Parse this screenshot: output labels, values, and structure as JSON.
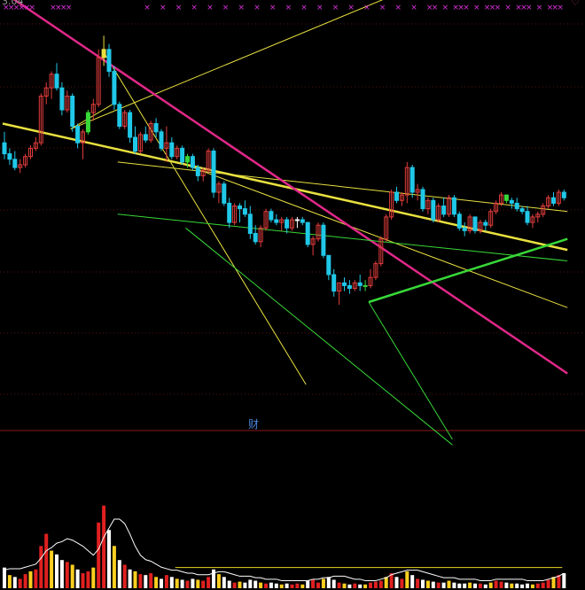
{
  "top_label": "3.04",
  "mid_label": "财",
  "colors": {
    "background": "#000000",
    "up": "#e23c3c",
    "down": "#20c8e8",
    "flat": "#ffffff",
    "marker": "#e030e0",
    "trend_yellow": "#e8e040",
    "trend_magenta": "#e02888",
    "trend_green": "#38d838",
    "volume_up": "#e02020",
    "volume_alt": "#ffd020",
    "volume_flat": "#ffffff",
    "avg_line": "#ffffff",
    "ref_line": "#e8d820"
  },
  "chart_data": {
    "type": "candlestick",
    "price_scale": [
      0,
      40
    ],
    "volume_scale": [
      0,
      100
    ],
    "candles": [
      [
        14.0,
        16.0,
        11.0,
        12.0
      ],
      [
        12.0,
        13.0,
        10.0,
        11.0
      ],
      [
        11.0,
        12.5,
        9.0,
        9.5
      ],
      [
        9.5,
        11.0,
        8.5,
        10.0
      ],
      [
        10.0,
        12.0,
        9.5,
        11.5
      ],
      [
        11.5,
        13.5,
        11.0,
        13.0
      ],
      [
        13.0,
        15.0,
        12.5,
        14.0
      ],
      [
        14.0,
        23.0,
        13.5,
        22.5
      ],
      [
        22.5,
        25.0,
        21.0,
        24.0
      ],
      [
        24.0,
        27.0,
        22.0,
        26.5
      ],
      [
        26.5,
        28.5,
        23.5,
        24.0
      ],
      [
        24.0,
        25.0,
        19.0,
        20.0
      ],
      [
        20.0,
        23.5,
        19.5,
        22.5
      ],
      [
        22.5,
        23.0,
        16.0,
        17.0
      ],
      [
        17.0,
        17.5,
        13.0,
        14.0
      ],
      [
        14.0,
        16.5,
        11.0,
        16.0
      ],
      [
        16.0,
        20.0,
        15.5,
        19.5
      ],
      [
        19.5,
        22.0,
        18.0,
        21.0
      ],
      [
        21.0,
        31.0,
        20.5,
        29.5
      ],
      [
        29.5,
        33.5,
        28.0,
        31.0
      ],
      [
        31.0,
        32.0,
        26.0,
        27.0
      ],
      [
        27.0,
        28.0,
        20.0,
        21.0
      ],
      [
        21.0,
        21.5,
        16.5,
        17.0
      ],
      [
        17.0,
        20.0,
        16.5,
        19.5
      ],
      [
        19.5,
        20.0,
        14.0,
        15.0
      ],
      [
        15.0,
        17.0,
        12.0,
        12.5
      ],
      [
        12.5,
        16.0,
        12.0,
        15.5
      ],
      [
        15.5,
        17.0,
        14.0,
        14.5
      ],
      [
        14.5,
        18.0,
        14.0,
        17.5
      ],
      [
        17.5,
        18.5,
        15.0,
        16.0
      ],
      [
        16.0,
        16.5,
        12.5,
        13.0
      ],
      [
        13.0,
        17.0,
        10.5,
        14.0
      ],
      [
        14.0,
        15.0,
        11.0,
        11.5
      ],
      [
        11.5,
        13.5,
        11.0,
        13.0
      ],
      [
        13.0,
        13.5,
        10.0,
        10.5
      ],
      [
        10.5,
        12.0,
        9.5,
        11.5
      ],
      [
        11.5,
        12.0,
        9.0,
        9.5
      ],
      [
        9.5,
        10.0,
        7.0,
        8.0
      ],
      [
        8.0,
        9.5,
        7.0,
        9.0
      ],
      [
        9.0,
        13.0,
        8.5,
        12.5
      ],
      [
        12.5,
        13.0,
        4.0,
        5.0
      ],
      [
        5.0,
        7.0,
        3.0,
        6.5
      ],
      [
        6.5,
        7.0,
        2.5,
        3.0
      ],
      [
        3.0,
        4.0,
        -1.5,
        -0.5
      ],
      [
        -0.5,
        3.0,
        -1.0,
        2.5
      ],
      [
        2.5,
        3.0,
        -0.5,
        2.0
      ],
      [
        2.0,
        3.5,
        0.5,
        1.0
      ],
      [
        1.0,
        2.5,
        -3.5,
        -2.5
      ],
      [
        -2.5,
        -1.0,
        -4.5,
        -4.0
      ],
      [
        -4.0,
        -1.0,
        -5.0,
        -1.5
      ],
      [
        -1.5,
        2.0,
        -2.0,
        1.5
      ],
      [
        1.5,
        2.0,
        -0.5,
        0.0
      ],
      [
        0.0,
        1.0,
        -1.0,
        -0.5
      ],
      [
        -0.5,
        0.5,
        -2.0,
        0.0
      ],
      [
        0.0,
        0.5,
        -2.5,
        -1.5
      ],
      [
        -1.5,
        0.5,
        -2.0,
        0.0
      ],
      [
        0.0,
        0.5,
        -1.5,
        0.0
      ],
      [
        0.0,
        0.5,
        -1.0,
        -0.5
      ],
      [
        -0.5,
        -0.5,
        -5.0,
        -4.5
      ],
      [
        -4.5,
        -3.0,
        -6.5,
        -3.5
      ],
      [
        -3.5,
        -0.5,
        -4.0,
        -1.0
      ],
      [
        -1.0,
        -0.5,
        -7.0,
        -6.5
      ],
      [
        -6.5,
        -7.0,
        -11.0,
        -10.0
      ],
      [
        -10.0,
        -9.0,
        -14.0,
        -13.0
      ],
      [
        -13.0,
        -11.5,
        -15.5,
        -11.5
      ],
      [
        -11.5,
        -10.5,
        -13.0,
        -12.0
      ],
      [
        -12.0,
        -11.0,
        -13.5,
        -12.5
      ],
      [
        -12.5,
        -11.0,
        -13.0,
        -11.5
      ],
      [
        -11.5,
        -10.0,
        -13.0,
        -12.0
      ],
      [
        -12.0,
        -11.0,
        -13.0,
        -12.0
      ],
      [
        -12.0,
        -9.0,
        -12.5,
        -10.5
      ],
      [
        -10.5,
        -7.5,
        -11.0,
        -8.0
      ],
      [
        -8.0,
        -3.0,
        -8.5,
        -3.5
      ],
      [
        -3.5,
        1.0,
        -4.0,
        0.5
      ],
      [
        0.5,
        5.5,
        0.0,
        5.0
      ],
      [
        5.0,
        6.0,
        3.0,
        3.5
      ],
      [
        3.5,
        5.0,
        2.5,
        4.5
      ],
      [
        4.5,
        10.5,
        3.0,
        9.5
      ],
      [
        9.5,
        10.0,
        4.0,
        5.0
      ],
      [
        5.0,
        6.5,
        3.5,
        5.5
      ],
      [
        5.5,
        6.0,
        1.5,
        2.0
      ],
      [
        2.0,
        4.0,
        1.0,
        3.5
      ],
      [
        3.5,
        4.0,
        -0.5,
        0.0
      ],
      [
        0.0,
        3.0,
        -0.5,
        2.5
      ],
      [
        2.5,
        4.0,
        0.5,
        1.0
      ],
      [
        1.0,
        4.5,
        0.5,
        4.0
      ],
      [
        4.0,
        4.5,
        0.5,
        1.0
      ],
      [
        1.0,
        1.5,
        -2.0,
        -1.5
      ],
      [
        -1.5,
        -0.5,
        -3.0,
        -2.0
      ],
      [
        -2.0,
        1.0,
        -2.5,
        0.5
      ],
      [
        0.5,
        0.5,
        -2.5,
        -2.0
      ],
      [
        -2.0,
        0.0,
        -2.5,
        -0.5
      ],
      [
        -0.5,
        0.0,
        -2.0,
        -1.0
      ],
      [
        -1.0,
        2.0,
        -1.5,
        1.5
      ],
      [
        1.5,
        3.5,
        1.0,
        3.0
      ],
      [
        3.0,
        5.0,
        2.5,
        4.5
      ],
      [
        4.5,
        4.5,
        3.0,
        3.5
      ],
      [
        3.5,
        4.0,
        2.0,
        3.0
      ],
      [
        3.0,
        4.0,
        1.5,
        2.0
      ],
      [
        2.0,
        2.5,
        1.0,
        1.5
      ],
      [
        1.5,
        2.5,
        -1.0,
        -0.5
      ],
      [
        -0.5,
        1.0,
        -1.5,
        0.5
      ],
      [
        0.5,
        1.5,
        -0.5,
        1.0
      ],
      [
        1.0,
        3.0,
        0.5,
        2.5
      ],
      [
        2.5,
        4.5,
        2.0,
        4.0
      ],
      [
        4.0,
        5.0,
        2.5,
        3.0
      ],
      [
        3.0,
        5.5,
        2.5,
        5.0
      ],
      [
        5.0,
        5.5,
        3.5,
        4.0
      ]
    ],
    "volumes": [
      22,
      14,
      12,
      10,
      15,
      18,
      20,
      45,
      58,
      40,
      36,
      30,
      28,
      25,
      20,
      16,
      18,
      22,
      70,
      88,
      62,
      45,
      30,
      25,
      20,
      18,
      15,
      14,
      16,
      12,
      10,
      14,
      12,
      10,
      9,
      8,
      10,
      9,
      8,
      12,
      20,
      15,
      12,
      8,
      6,
      7,
      6,
      9,
      8,
      6,
      5,
      6,
      5,
      4,
      5,
      4,
      5,
      4,
      8,
      9,
      6,
      10,
      12,
      9,
      6,
      5,
      4,
      5,
      4,
      4,
      6,
      7,
      8,
      12,
      16,
      12,
      10,
      18,
      14,
      10,
      9,
      8,
      7,
      6,
      6,
      8,
      6,
      5,
      5,
      6,
      5,
      5,
      4,
      6,
      8,
      7,
      6,
      5,
      5,
      4,
      5,
      4,
      5,
      6,
      9,
      12,
      14,
      16
    ],
    "volume_ma": [
      12,
      13,
      13,
      13,
      14,
      15,
      16,
      20,
      25,
      27,
      30,
      31,
      33,
      32,
      30,
      28,
      25,
      22,
      26,
      34,
      40,
      46,
      46,
      43,
      36,
      28,
      22,
      19,
      18,
      16,
      14,
      13,
      12,
      12,
      11,
      10,
      10,
      9,
      9,
      9,
      10,
      11,
      11,
      10,
      9,
      8,
      8,
      8,
      7,
      7,
      6,
      6,
      6,
      5,
      5,
      5,
      5,
      5,
      5,
      6,
      6,
      7,
      7,
      8,
      8,
      8,
      7,
      6,
      6,
      5,
      5,
      5,
      6,
      7,
      9,
      10,
      11,
      12,
      12,
      12,
      11,
      10,
      9,
      8,
      7,
      7,
      7,
      6,
      6,
      6,
      6,
      5,
      5,
      5,
      6,
      6,
      6,
      6,
      6,
      6,
      5,
      5,
      5,
      5,
      6,
      7,
      8,
      10
    ],
    "volume_ref_level": 10,
    "trendlines": [
      {
        "color": "trend_yellow",
        "width": 1,
        "from": [
          13,
          16.5
        ],
        "to": [
          108,
          54
        ]
      },
      {
        "color": "trend_yellow",
        "width": 1,
        "from": [
          13,
          16.5
        ],
        "to": [
          21,
          21.0
        ]
      },
      {
        "color": "trend_yellow",
        "width": 1,
        "from": [
          22,
          10.5
        ],
        "to": [
          108,
          1.5
        ]
      },
      {
        "color": "trend_yellow",
        "width": 2.5,
        "from": [
          0,
          17.5
        ],
        "to": [
          108,
          -5.5
        ]
      },
      {
        "color": "trend_yellow",
        "width": 1,
        "from": [
          19,
          31
        ],
        "to": [
          58,
          -30
        ]
      },
      {
        "color": "trend_yellow",
        "width": 1,
        "from": [
          35,
          10
        ],
        "to": [
          108,
          -16
        ]
      },
      {
        "color": "trend_magenta",
        "width": 2.5,
        "from": [
          0,
          41.5
        ],
        "to": [
          108,
          -28
        ]
      },
      {
        "color": "trend_green",
        "width": 1,
        "from": [
          22,
          1
        ],
        "to": [
          108,
          -7.5
        ]
      },
      {
        "color": "trend_green",
        "width": 1,
        "from": [
          35,
          -1.5
        ],
        "to": [
          86,
          -41
        ]
      },
      {
        "color": "trend_green",
        "width": 1,
        "from": [
          70,
          -15
        ],
        "to": [
          86,
          -40
        ]
      },
      {
        "color": "trend_green",
        "width": 2.5,
        "from": [
          70,
          -15
        ],
        "to": [
          108,
          -3.5
        ]
      }
    ],
    "markers_top": [
      0,
      1,
      2,
      3,
      4,
      5,
      9,
      10,
      11,
      12,
      26,
      27,
      28,
      29,
      30,
      31,
      32,
      33,
      34,
      35,
      36,
      37,
      38,
      39,
      40,
      41,
      42,
      43,
      44,
      45,
      46,
      47,
      48,
      49,
      50,
      51,
      52,
      53,
      54,
      55,
      56,
      57,
      58,
      59,
      60,
      61,
      62,
      63,
      64,
      65,
      66,
      67,
      68,
      69,
      70,
      71,
      72,
      73,
      74,
      75,
      76,
      77,
      78,
      79,
      80,
      81,
      82,
      83,
      84,
      85,
      86,
      87,
      88,
      89,
      90,
      91,
      92,
      93,
      94,
      95,
      96,
      97,
      98,
      99,
      100,
      101,
      102,
      103,
      104,
      105,
      106,
      107
    ]
  }
}
